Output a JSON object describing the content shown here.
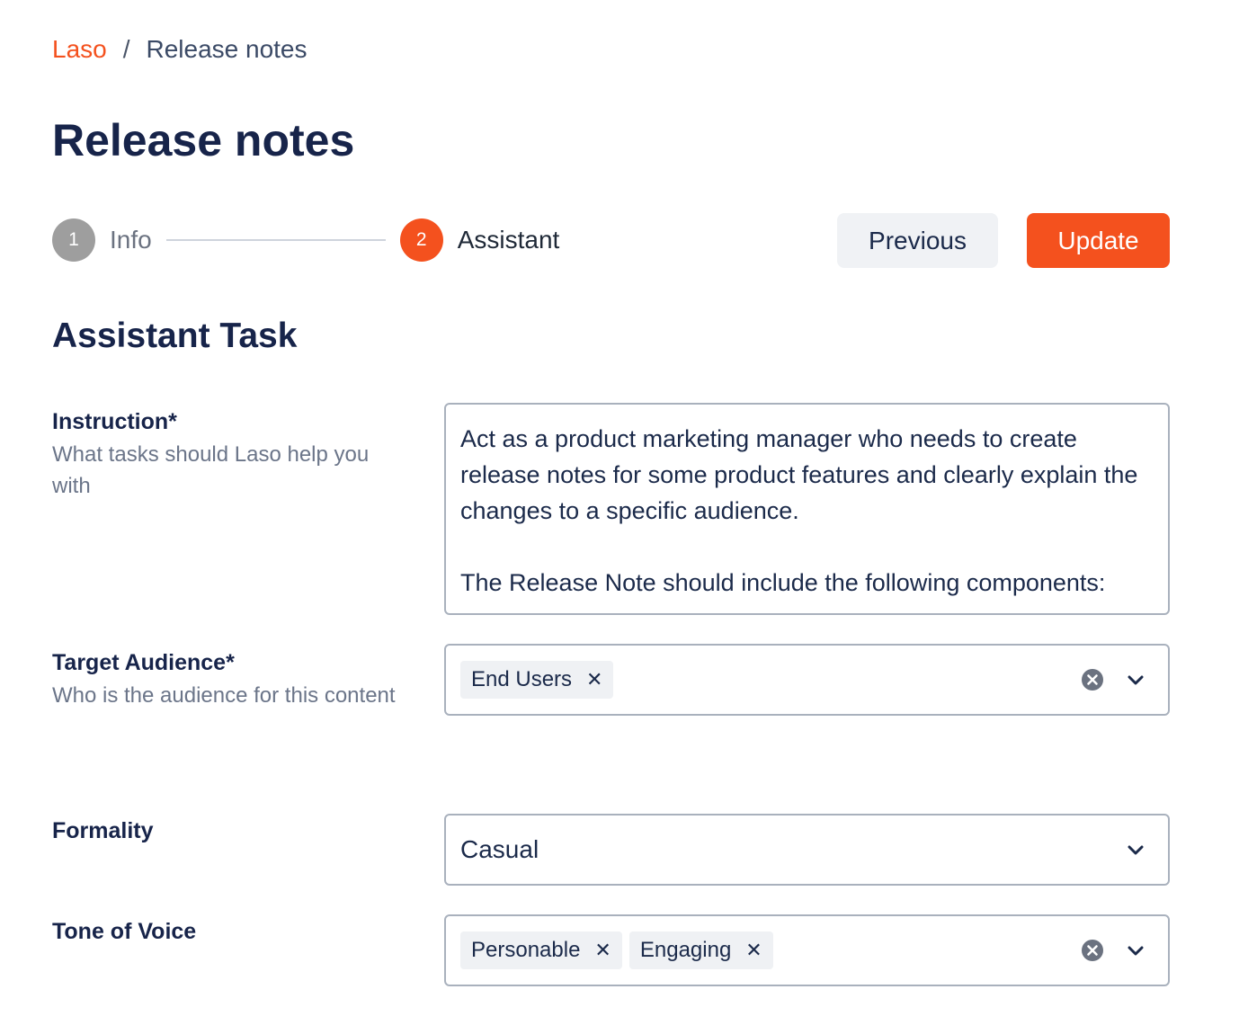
{
  "breadcrumb": {
    "root": "Laso",
    "separator": "/",
    "current": "Release notes"
  },
  "page_title": "Release notes",
  "stepper": {
    "steps": [
      {
        "number": "1",
        "label": "Info",
        "state": "complete"
      },
      {
        "number": "2",
        "label": "Assistant",
        "state": "active"
      }
    ]
  },
  "actions": {
    "previous_label": "Previous",
    "update_label": "Update"
  },
  "section_title": "Assistant Task",
  "fields": {
    "instruction": {
      "label": "Instruction*",
      "help": "What tasks should Laso help you with",
      "value": "Act as a product marketing manager who needs to create release notes for some product features and clearly explain the changes to a specific audience.\n\nThe Release Note should include the following components:"
    },
    "target_audience": {
      "label": "Target Audience*",
      "help": "Who is the audience for this content",
      "selected": [
        "End Users"
      ]
    },
    "formality": {
      "label": "Formality",
      "value": "Casual"
    },
    "tone_of_voice": {
      "label": "Tone of Voice",
      "selected": [
        "Personable",
        "Engaging"
      ]
    }
  },
  "icons": {
    "chip_remove": "close-icon",
    "clear": "clear-circle-icon",
    "dropdown": "chevron-down-icon"
  },
  "colors": {
    "accent": "#f4511e",
    "title": "#17244a",
    "step_complete": "#9e9e9e",
    "muted": "#6b7589"
  }
}
